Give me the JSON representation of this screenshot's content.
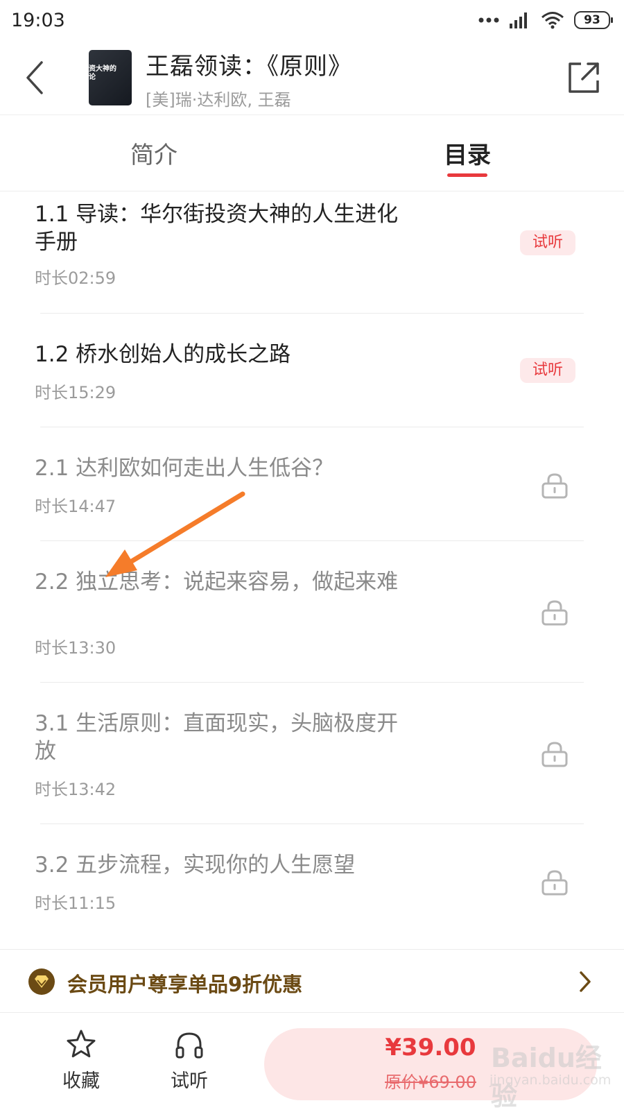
{
  "status_bar": {
    "time": "19:03",
    "battery": "93"
  },
  "header": {
    "title": "王磊领读：《原则》",
    "author": "[美]瑞·达利欧, 王磊",
    "cover_text": "资大神的\n论"
  },
  "tabs": [
    {
      "label": "简介",
      "active": false
    },
    {
      "label": "目录",
      "active": true
    }
  ],
  "chapters": [
    {
      "title": "1.1 导读：华尔街投资大神的人生进化手册",
      "duration": "时长02:59",
      "status": "free",
      "badge": "试听"
    },
    {
      "title": "1.2 桥水创始人的成长之路",
      "duration": "时长15:29",
      "status": "free",
      "badge": "试听"
    },
    {
      "title": "2.1 达利欧如何走出人生低谷？",
      "duration": "时长14:47",
      "status": "locked",
      "icon": "lock-icon"
    },
    {
      "title": "2.2 独立思考：说起来容易，做起来难",
      "duration": "时长13:30",
      "status": "locked",
      "icon": "lock-icon"
    },
    {
      "title": "3.1 生活原则：直面现实，头脑极度开放",
      "duration": "时长13:42",
      "status": "locked",
      "icon": "lock-icon"
    },
    {
      "title": "3.2 五步流程，实现你的人生愿望",
      "duration": "时长11:15",
      "status": "locked",
      "icon": "lock-icon"
    }
  ],
  "promo": {
    "text": "会员用户尊享单品9折优惠"
  },
  "bottom_bar": {
    "favorite_label": "收藏",
    "listen_label": "试听",
    "price": "¥39.00",
    "original_price": "原价¥69.00"
  },
  "watermark": {
    "main": "Baidu经验",
    "sub": "jingyan.baidu.com"
  },
  "colors": {
    "accent": "#e8393d",
    "badge_bg": "#fde9ea",
    "promo_text": "#6b4a14",
    "arrow": "#f57c2a"
  }
}
